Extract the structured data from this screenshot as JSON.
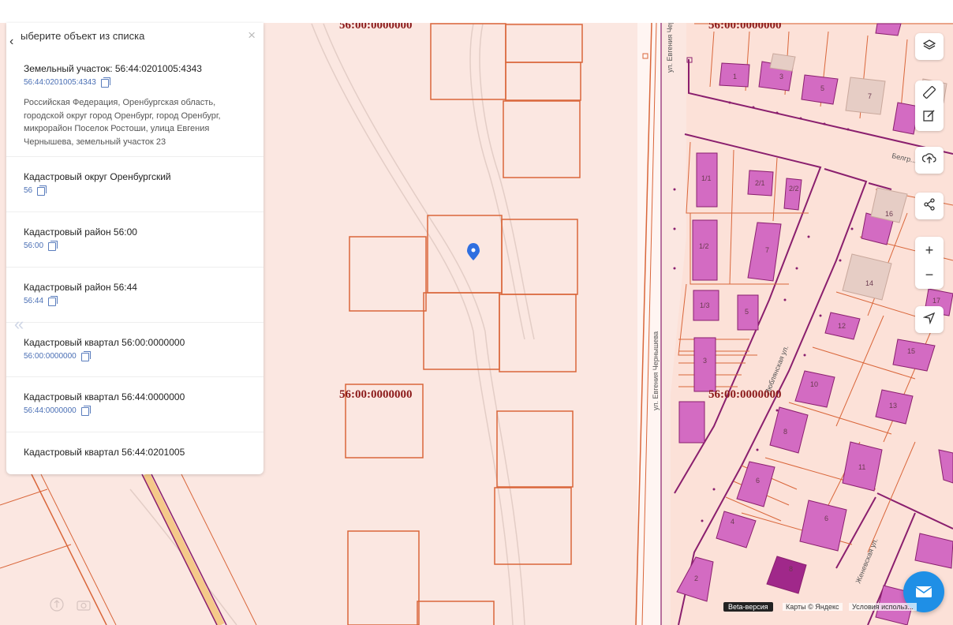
{
  "panel": {
    "title": "ыберите объект из списка",
    "items": [
      {
        "title": "Земельный участок: 56:44:0201005:4343",
        "number": "56:44:0201005:4343",
        "address": "Российская Федерация, Оренбургская область, городской округ город Оренбург, город Оренбург, микрорайон Поселок Ростоши, улица Евгения Чернышева, земельный участок 23"
      },
      {
        "title": "Кадастровый округ Оренбургский",
        "number": "56"
      },
      {
        "title": "Кадастровый район 56:00",
        "number": "56:00"
      },
      {
        "title": "Кадастровый район 56:44",
        "number": "56:44"
      },
      {
        "title": "Кадастровый квартал 56:00:0000000",
        "number": "56:00:0000000"
      },
      {
        "title": "Кадастровый квартал 56:44:0000000",
        "number": "56:44:0000000"
      },
      {
        "title": "Кадастровый квартал 56:44:0201005"
      }
    ]
  },
  "map": {
    "quarter_labels": [
      "56:00:0000000",
      "56:00:0000000",
      "56:00:0000000",
      "56:00:0000000"
    ],
    "streets": [
      "ул. Евгения Чернышева",
      "ул. Евгения Чернышева",
      "Белгр... ул.",
      "Люблянская ул.",
      "Женевская ул."
    ],
    "parcel_numbers": [
      "1",
      "3",
      "5",
      "7",
      "1/1",
      "2/1",
      "2/2",
      "16",
      "1/2",
      "7",
      "14",
      "1/3",
      "5",
      "17",
      "12",
      "3",
      "15",
      "10",
      "13",
      "8",
      "11",
      "6",
      "4",
      "6",
      "8",
      "2"
    ]
  },
  "footer": {
    "beta": "Beta-версия",
    "copyright": "Карты © Яндекс",
    "terms": "Условия использ..."
  },
  "icons": {
    "layers": "layers-icon",
    "ruler": "ruler-icon",
    "edit": "edit-icon",
    "upload": "upload-icon",
    "share": "share-icon",
    "zoom_in": "plus-icon",
    "zoom_out": "minus-icon",
    "locate": "locate-icon",
    "mail": "mail-icon",
    "marker": "map-marker-icon"
  },
  "colors": {
    "map_bg": "#fbe7e1",
    "parcel_line": "#d9663a",
    "boundary": "#8a1f6e",
    "building": "#d36bc2",
    "quarter_label": "#8b1a1a",
    "accent": "#1f8fe6"
  }
}
